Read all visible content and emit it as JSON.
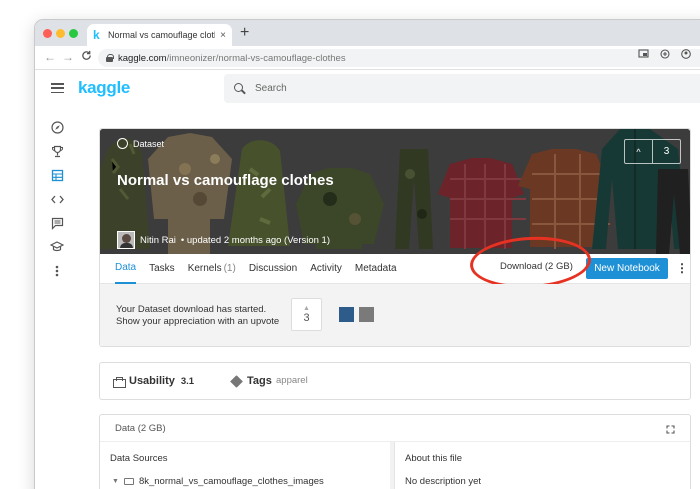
{
  "browser": {
    "tab_title": "Normal vs camouflage clothes",
    "tab_close": "×",
    "new_tab": "+",
    "url_host": "kaggle.com",
    "url_path": "/imneonizer/normal-vs-camouflage-clothes",
    "nav_back": "←",
    "nav_forward": "→",
    "nav_reload": "C",
    "omnibox_icons": [
      "cast-icon",
      "add-icon",
      "account-icon"
    ]
  },
  "header": {
    "logo": "kaggle",
    "search_placeholder": "Search"
  },
  "sidebar": {
    "items": [
      "compass-icon",
      "trophy-icon",
      "table-icon",
      "code-icon",
      "comments-icon",
      "school-icon",
      "more-vertical-icon"
    ],
    "active_index": 2
  },
  "dataset": {
    "type_label": "Dataset",
    "title": "Normal vs camouflage clothes",
    "owner_name": "Nitin Rai",
    "owner_meta": "• updated 2 months ago (Version 1)",
    "upvote_count": "3",
    "upvote_arrow": "^"
  },
  "tabs": [
    {
      "label": "Data",
      "count": ""
    },
    {
      "label": "Tasks",
      "count": ""
    },
    {
      "label": "Kernels",
      "count": "(1)"
    },
    {
      "label": "Discussion",
      "count": ""
    },
    {
      "label": "Activity",
      "count": ""
    },
    {
      "label": "Metadata",
      "count": ""
    }
  ],
  "actions": {
    "download_label": "Download (2 GB)",
    "new_notebook_label": "New Notebook",
    "more_label": "⋮"
  },
  "notice": {
    "line1": "Your Dataset download has started.",
    "line2": "Show your appreciation with an upvote",
    "vote_count": "3",
    "vote_arrow": "▲"
  },
  "usability": {
    "label": "Usability",
    "value": "3.1",
    "tags_label": "Tags",
    "tags_value": "apparel"
  },
  "data_panel": {
    "header": "Data (2 GB)",
    "sources_title": "Data Sources",
    "about_title": "About this file",
    "file_name": "8k_normal_vs_camouflage_clothes_images",
    "no_description": "No description yet"
  },
  "colors": {
    "kaggle_blue": "#20beff",
    "primary_button": "#1e90d6",
    "highlight_ring": "#e63222"
  }
}
